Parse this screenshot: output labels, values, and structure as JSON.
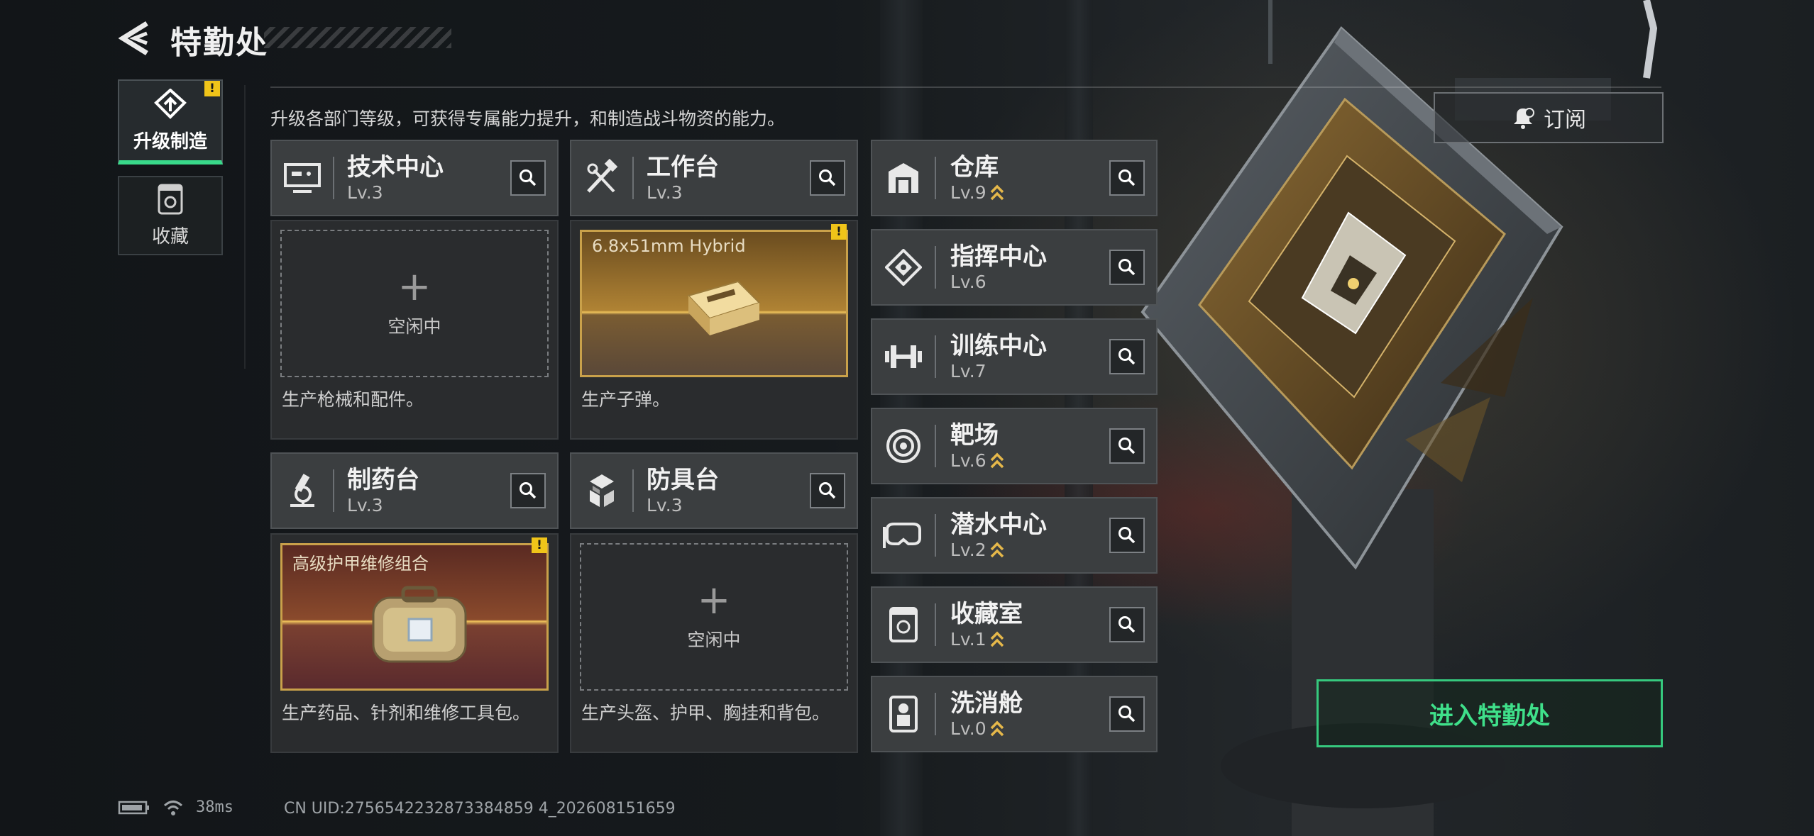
{
  "header": {
    "title": "特勤处"
  },
  "side_tabs": [
    {
      "label": "升级制造",
      "icon": "upgrade-icon",
      "active": true,
      "badge": "!"
    },
    {
      "label": "收藏",
      "icon": "collection-icon",
      "active": false
    }
  ],
  "description": "升级各部门等级，可获得专属能力提升，和制造战斗物资的能力。",
  "subscribe": {
    "label": "订阅",
    "icon": "bell-icon"
  },
  "workshops": [
    {
      "name": "技术中心",
      "level": "Lv.3",
      "icon": "monitor-icon",
      "slot": {
        "state": "idle",
        "idle_label": "空闲中"
      },
      "caption": "生产枪械和配件。"
    },
    {
      "name": "工作台",
      "level": "Lv.3",
      "icon": "tools-icon",
      "slot": {
        "state": "producing",
        "product": "6.8x51mm Hybrid",
        "badge": "!"
      },
      "caption": "生产子弹。"
    },
    {
      "name": "制药台",
      "level": "Lv.3",
      "icon": "microscope-icon",
      "slot": {
        "state": "producing",
        "product": "高级护甲维修组合",
        "badge": "!"
      },
      "caption": "生产药品、针剂和维修工具包。"
    },
    {
      "name": "防具台",
      "level": "Lv.3",
      "icon": "armor-icon",
      "slot": {
        "state": "idle",
        "idle_label": "空闲中"
      },
      "caption": "生产头盔、护甲、胸挂和背包。"
    }
  ],
  "departments": [
    {
      "name": "仓库",
      "level": "Lv.9",
      "icon": "warehouse-icon",
      "upgradable": true
    },
    {
      "name": "指挥中心",
      "level": "Lv.6",
      "icon": "command-icon",
      "upgradable": false
    },
    {
      "name": "训练中心",
      "level": "Lv.7",
      "icon": "dumbbell-icon",
      "upgradable": false
    },
    {
      "name": "靶场",
      "level": "Lv.6",
      "icon": "target-icon",
      "upgradable": true
    },
    {
      "name": "潜水中心",
      "level": "Lv.2",
      "icon": "diving-mask-icon",
      "upgradable": true
    },
    {
      "name": "收藏室",
      "level": "Lv.1",
      "icon": "display-case-icon",
      "upgradable": true
    },
    {
      "name": "洗消舱",
      "level": "Lv.0",
      "icon": "decon-suit-icon",
      "upgradable": true
    }
  ],
  "enter_button": {
    "label": "进入特勤处"
  },
  "status_bar": {
    "ping": "38ms",
    "uid": "CN UID:2756542232873384859 4_202608151659"
  },
  "colors": {
    "accent_green": "#39d98a",
    "warning_yellow": "#f0c419",
    "upgrade_gold": "#e6b84a"
  }
}
